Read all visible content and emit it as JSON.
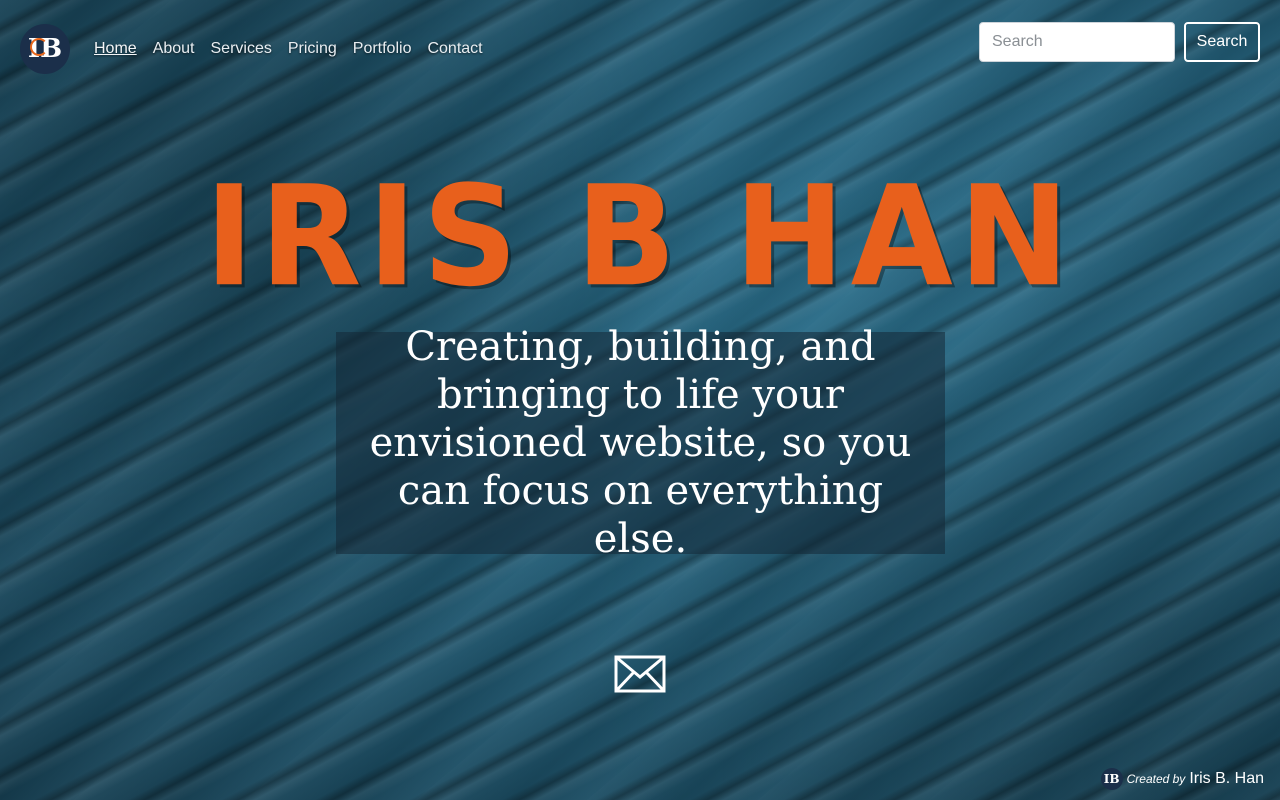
{
  "brand": {
    "logo_text": "IB",
    "logo_icon": "ib-monogram-logo"
  },
  "nav": {
    "items": [
      {
        "label": "Home",
        "active": true
      },
      {
        "label": "About",
        "active": false
      },
      {
        "label": "Services",
        "active": false
      },
      {
        "label": "Pricing",
        "active": false
      },
      {
        "label": "Portfolio",
        "active": false
      },
      {
        "label": "Contact",
        "active": false
      }
    ]
  },
  "search": {
    "placeholder": "Search",
    "button_label": "Search"
  },
  "hero": {
    "title": "IRIS B HAN",
    "tagline": "Creating, building, and bringing to life your envisioned website, so you can focus on everything else.",
    "contact_icon": "envelope-icon"
  },
  "footer": {
    "created_by": "Created by",
    "author": "Iris B. Han"
  },
  "colors": {
    "accent": "#e8601c",
    "logo_bg": "#1b2f4a",
    "background": "#1f5a73"
  }
}
